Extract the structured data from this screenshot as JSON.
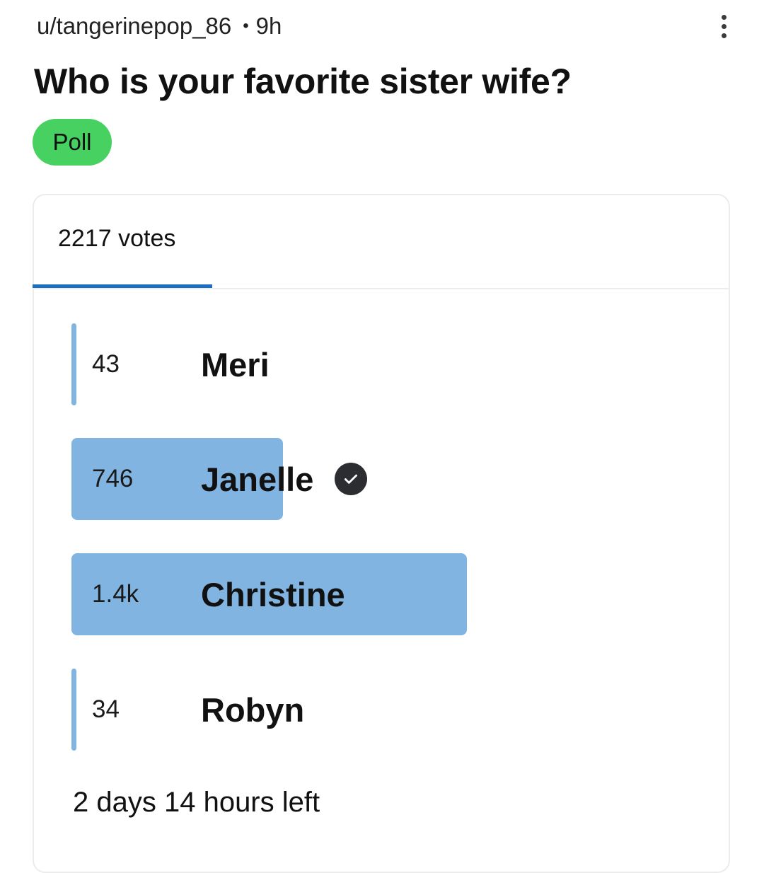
{
  "post": {
    "author": "u/tangerinepop_86",
    "separator": "•",
    "age": "9h",
    "title": "Who is your favorite sister wife?",
    "flair": "Poll",
    "flair_color": "#46d160"
  },
  "poll": {
    "votes_tab": "2217 votes",
    "accent_color": "#1b6fc2",
    "bar_color": "#82b4e2",
    "options": [
      {
        "count": "43",
        "label": "Meri",
        "votes": 43,
        "share": 0.019,
        "chosen": false
      },
      {
        "count": "746",
        "label": "Janelle",
        "votes": 746,
        "share": 0.336,
        "chosen": true
      },
      {
        "count": "1.4k",
        "label": "Christine",
        "votes": 1394,
        "share": 0.629,
        "chosen": false
      },
      {
        "count": "34",
        "label": "Robyn",
        "votes": 34,
        "share": 0.015,
        "chosen": false
      }
    ],
    "time_left": "2 days 14 hours left"
  },
  "icons": {
    "more": "vertical-dots-icon",
    "selected": "check-circle-icon"
  }
}
